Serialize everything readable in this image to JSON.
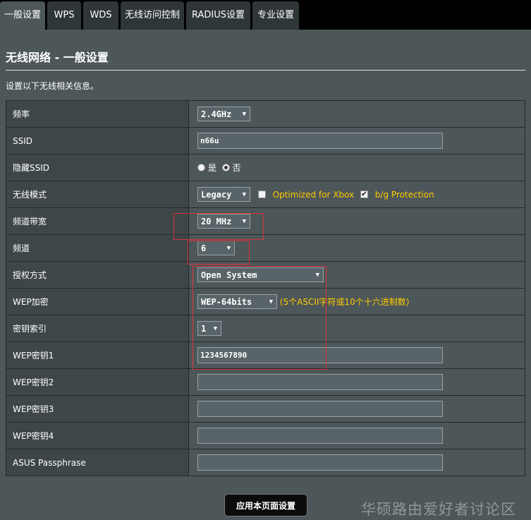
{
  "tabs": [
    {
      "label": "一般设置",
      "active": true
    },
    {
      "label": "WPS",
      "active": false
    },
    {
      "label": "WDS",
      "active": false
    },
    {
      "label": "无线访问控制",
      "active": false
    },
    {
      "label": "RADIUS设置",
      "active": false
    },
    {
      "label": "专业设置",
      "active": false
    }
  ],
  "page_title": "无线网络 - 一般设置",
  "description": "设置以下无线相关信息。",
  "rows": {
    "band": {
      "label": "频率",
      "value": "2.4GHz"
    },
    "ssid": {
      "label": "SSID",
      "value": "n66u"
    },
    "hide_ssid": {
      "label": "隐藏SSID",
      "yes_label": "是",
      "no_label": "否",
      "selected": "否"
    },
    "wireless_mode": {
      "label": "无线模式",
      "value": "Legacy",
      "xbox_label": "Optimized for Xbox",
      "xbox_checked": false,
      "bg_label": "b/g Protection",
      "bg_checked": true
    },
    "bandwidth": {
      "label": "频道带宽",
      "value": "20 MHz"
    },
    "channel": {
      "label": "频道",
      "value": "6"
    },
    "auth_method": {
      "label": "授权方式",
      "value": "Open System"
    },
    "wep_encryption": {
      "label": "WEP加密",
      "value": "WEP-64bits",
      "hint": "(5个ASCII字符或10个十六进制数)"
    },
    "key_index": {
      "label": "密钥索引",
      "value": "1"
    },
    "wep_key1": {
      "label": "WEP密钥1",
      "value": "1234567890"
    },
    "wep_key2": {
      "label": "WEP密钥2",
      "value": ""
    },
    "wep_key3": {
      "label": "WEP密钥3",
      "value": ""
    },
    "wep_key4": {
      "label": "WEP密钥4",
      "value": ""
    },
    "passphrase": {
      "label": "ASUS Passphrase",
      "value": ""
    }
  },
  "apply_button": "应用本页面设置",
  "watermark": "华硕路由爱好者讨论区",
  "colors": {
    "background": "#4d5659",
    "label_cell": "#3e4648",
    "highlight": "#ffcc00",
    "annotation": "#d8343a"
  }
}
